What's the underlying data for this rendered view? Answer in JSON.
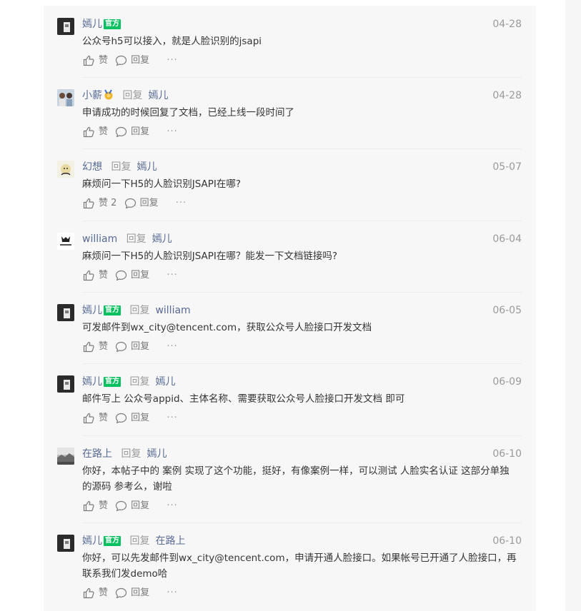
{
  "comments": [
    {
      "user": "嫣儿",
      "official": "官方",
      "reply_word": "",
      "reply_to": "",
      "date": "04-28",
      "content": "公众号h5可以接入，就是人脸识别的jsapi",
      "like": "赞",
      "like_count": "",
      "reply": "回复",
      "more": "···"
    },
    {
      "user": "小薪",
      "official": "",
      "reply_word": "回复",
      "reply_to": "嫣儿",
      "date": "04-28",
      "content": "申请成功的时候回复了文档，已经上线一段时间了",
      "like": "赞",
      "like_count": "",
      "reply": "回复",
      "more": "···"
    },
    {
      "user": "幻想",
      "official": "",
      "reply_word": "回复",
      "reply_to": "嫣儿",
      "date": "05-07",
      "content": "麻烦问一下H5的人脸识别JSAPI在哪?",
      "like": "赞",
      "like_count": "2",
      "reply": "回复",
      "more": "···"
    },
    {
      "user": "william",
      "official": "",
      "reply_word": "回复",
      "reply_to": "嫣儿",
      "date": "06-04",
      "content": "麻烦问一下H5的人脸识别JSAPI在哪？能发一下文档链接吗?",
      "like": "赞",
      "like_count": "",
      "reply": "回复",
      "more": "···"
    },
    {
      "user": "嫣儿",
      "official": "官方",
      "reply_word": "回复",
      "reply_to": "william",
      "date": "06-05",
      "content": "可发邮件到wx_city@tencent.com，获取公众号人脸接口开发文档",
      "like": "赞",
      "like_count": "",
      "reply": "回复",
      "more": "···"
    },
    {
      "user": "嫣儿",
      "official": "官方",
      "reply_word": "回复",
      "reply_to": "嫣儿",
      "date": "06-09",
      "content": "邮件写上 公众号appid、主体名称、需要获取公众号人脸接口开发文档 即可",
      "like": "赞",
      "like_count": "",
      "reply": "回复",
      "more": "···"
    },
    {
      "user": "在路上",
      "official": "",
      "reply_word": "回复",
      "reply_to": "嫣儿",
      "date": "06-10",
      "content": "你好，本帖子中的 案例 实现了这个功能，挺好，有像案例一样，可以测试 人脸实名认证 这部分单独的源码 参考么，谢啦",
      "like": "赞",
      "like_count": "",
      "reply": "回复",
      "more": "···"
    },
    {
      "user": "嫣儿",
      "official": "官方",
      "reply_word": "回复",
      "reply_to": "在路上",
      "date": "06-10",
      "content": "你好，可以先发邮件到wx_city@tencent.com，申请开通人脸接口。如果帐号已开通了人脸接口，再联系我们发demo哈",
      "like": "赞",
      "like_count": "",
      "reply": "回复",
      "more": "···"
    }
  ],
  "colors": {
    "username": "#576b95",
    "official_badge": "#07c160",
    "meta_gray": "#9a9a9a",
    "text": "#353535"
  }
}
